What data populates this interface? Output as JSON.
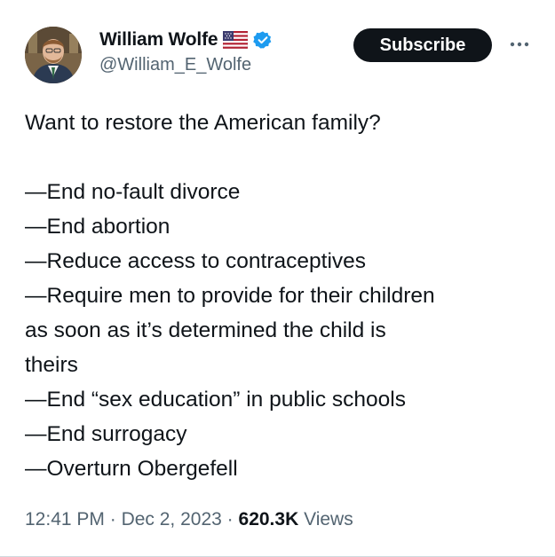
{
  "author": {
    "display_name": "William Wolfe",
    "handle": "@William_E_Wolfe",
    "flag_icon": "us-flag-icon",
    "verified_icon": "verified-badge-icon",
    "verified_color": "#1d9bf0"
  },
  "actions": {
    "subscribe_label": "Subscribe",
    "more_icon": "more-horizontal-icon"
  },
  "tweet": {
    "intro": "Want to restore the American family?",
    "items": [
      "—End no-fault divorce",
      "—End abortion",
      "—Reduce access to contraceptives",
      "—Require men to provide for their children",
      "as soon as it’s determined the child is",
      "theirs",
      "—End “sex education” in public schools",
      "—End surrogacy",
      "—Overturn Obergefell"
    ]
  },
  "meta": {
    "time": "12:41 PM",
    "separator": "·",
    "date": "Dec 2, 2023",
    "views_count": "620.3K",
    "views_label": "Views"
  },
  "colors": {
    "text": "#0f1419",
    "secondary": "#536471",
    "button_bg": "#0f1419",
    "button_text": "#ffffff"
  }
}
